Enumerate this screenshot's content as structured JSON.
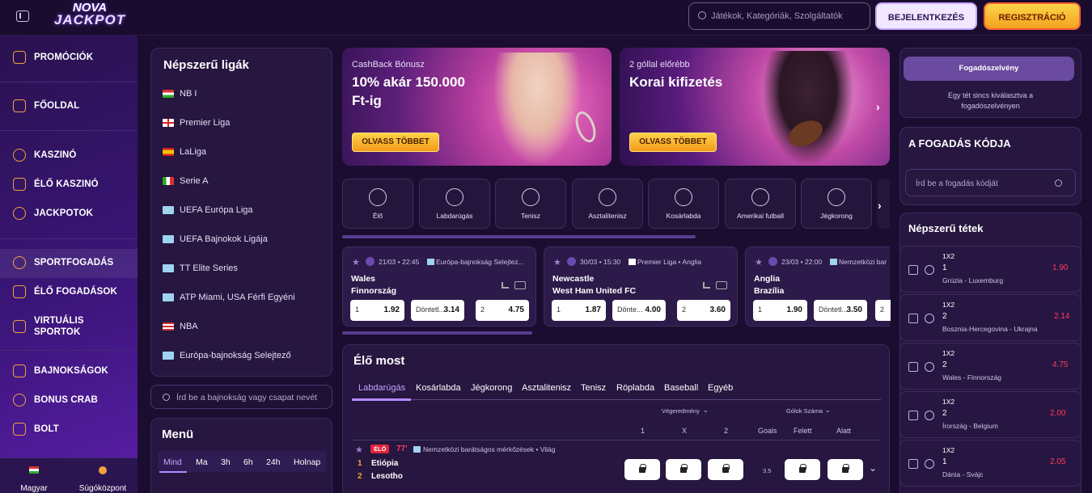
{
  "header": {
    "logo_line1": "NOVA",
    "logo_line2": "JACKPOT",
    "search_placeholder": "Játékok, Kategóriák, Szolgáltatók",
    "login_label": "BEJELENTKEZÉS",
    "register_label": "REGISZTRÁCIÓ"
  },
  "sidebar": {
    "items": [
      {
        "label": "PROMÓCIÓK",
        "icon": "gift-icon"
      },
      {
        "label": "FŐOLDAL",
        "icon": "home-icon"
      },
      {
        "label": "KASZINÓ",
        "icon": "casino-chip-icon"
      },
      {
        "label": "ÉLŐ KASZINÓ",
        "icon": "live-casino-icon"
      },
      {
        "label": "JACKPOTOK",
        "icon": "seven-icon"
      },
      {
        "label": "SPORTFOGADÁS",
        "icon": "soccer-ball-icon"
      },
      {
        "label": "ÉLŐ FOGADÁSOK",
        "icon": "live-play-icon"
      },
      {
        "label": "VIRTUÁLIS",
        "label2": "SPORTOK",
        "icon": "gamepad-icon"
      },
      {
        "label": "BAJNOKSÁGOK",
        "icon": "trophy-icon"
      },
      {
        "label": "BONUS CRAB",
        "icon": "crab-icon"
      },
      {
        "label": "BOLT",
        "icon": "bag-icon"
      }
    ],
    "language_label": "Magyar",
    "help_label": "Súgóközpont"
  },
  "leagues": {
    "title": "Népszerű ligák",
    "items": [
      {
        "label": "NB I",
        "flag": "hu"
      },
      {
        "label": "Premier Liga",
        "flag": "en"
      },
      {
        "label": "LaLiga",
        "flag": "es"
      },
      {
        "label": "Serie A",
        "flag": "it"
      },
      {
        "label": "UEFA Európa Liga",
        "flag": "world"
      },
      {
        "label": "UEFA Bajnokok Ligája",
        "flag": "world"
      },
      {
        "label": "TT Elite Series",
        "flag": "world"
      },
      {
        "label": "ATP Miami, USA Férfi Egyéni",
        "flag": "world"
      },
      {
        "label": "NBA",
        "flag": "us"
      },
      {
        "label": "Európa-bajnokság Selejtező",
        "flag": "world"
      }
    ],
    "search_placeholder": "Írd be a bajnokság vagy csapat nevét"
  },
  "menu": {
    "title": "Menü",
    "filters": [
      "Mind",
      "Ma",
      "3h",
      "6h",
      "24h",
      "Holnap"
    ]
  },
  "banners": [
    {
      "kicker": "CashBack Bónusz",
      "title1": "10% akár 150.000",
      "title2": "Ft-ig",
      "button": "OLVASS TÖBBET"
    },
    {
      "kicker": "2 góllal előrébb",
      "title1": "Korai kifizetés",
      "title2": "",
      "button": "OLVASS TÖBBET"
    }
  ],
  "sports": [
    "Élő",
    "Labdarúgás",
    "Tenisz",
    "Asztalitenisz",
    "Kosárlabda",
    "Amerikai futball",
    "Jégkorong"
  ],
  "matches": [
    {
      "time": "21/03 • 22:45",
      "league": "Európa-bajnokság Selejtez...",
      "home": "Wales",
      "away": "Finnország",
      "o1": "1.92",
      "ox_label": "Döntetl...",
      "ox": "3.14",
      "o2": "4.75"
    },
    {
      "time": "30/03 • 15:30",
      "league": "Premier Liga • Anglia",
      "home": "Newcastle",
      "away": "West Ham United FC",
      "o1": "1.87",
      "ox_label": "Dönte...",
      "ox": "4.00",
      "o2": "3.60"
    },
    {
      "time": "23/03 • 22:00",
      "league": "Nemzetközi bar",
      "home": "Anglia",
      "away": "Brazília",
      "o1": "1.90",
      "ox_label": "Döntetl...",
      "ox": "3.50",
      "o2": "2"
    }
  ],
  "live": {
    "title": "Élő most",
    "tabs": [
      "Labdarúgás",
      "Kosárlabda",
      "Jégkorong",
      "Asztalitenisz",
      "Tenisz",
      "Röplabda",
      "Baseball",
      "Egyéb"
    ],
    "group1": "Végeredmény",
    "group2": "Gólok Száma",
    "cols": [
      "1",
      "X",
      "2",
      "Goals",
      "Felett",
      "Alatt"
    ],
    "event": {
      "badge": "ÉLŐ",
      "minute": "77'",
      "league": "Nemzetközi barátságos mérkőzések • Világ",
      "home_score": "1",
      "home": "Etiópia",
      "away_score": "2",
      "away": "Lesotho",
      "goals": "3.5"
    }
  },
  "betslip": {
    "title": "Fogadószelvény",
    "empty_line1": "Egy tét sincs kiválasztva a",
    "empty_line2": "fogadószelvényen"
  },
  "bet_code": {
    "title": "A FOGADÁS KÓDJA",
    "placeholder": "Írd be a fogadás kódját"
  },
  "popular_bets": {
    "title": "Népszerű tétek",
    "items": [
      {
        "market": "1X2",
        "pick": "1",
        "match": "Grúzia - Luxemburg",
        "odd": "1.90"
      },
      {
        "market": "1X2",
        "pick": "2",
        "match": "Bosznia-Hercegovina - Ukrajna",
        "odd": "2.14"
      },
      {
        "market": "1X2",
        "pick": "2",
        "match": "Wales - Finnország",
        "odd": "4.75"
      },
      {
        "market": "1X2",
        "pick": "2",
        "match": "Írország - Belgium",
        "odd": "2.00"
      },
      {
        "market": "1X2",
        "pick": "1",
        "match": "Dánia - Svájc",
        "odd": "2.05"
      }
    ]
  },
  "colors": {
    "accent": "#f29a1b",
    "odds_red": "#ff3b5c",
    "panel": "#261640"
  }
}
